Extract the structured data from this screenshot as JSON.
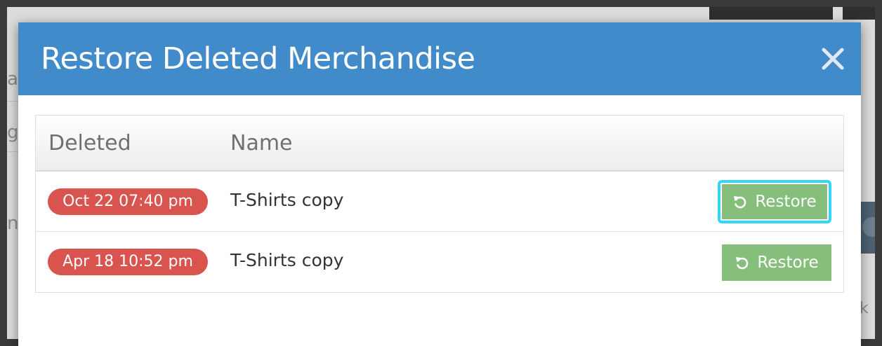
{
  "modal": {
    "title": "Restore Deleted Merchandise",
    "close_icon": "close-icon"
  },
  "table": {
    "columns": [
      "Deleted",
      "Name"
    ],
    "rows": [
      {
        "deleted": "Oct 22 07:40 pm",
        "name": "T-Shirts copy",
        "action": "Restore",
        "focused": true
      },
      {
        "deleted": "Apr 18 10:52 pm",
        "name": "T-Shirts copy",
        "action": "Restore",
        "focused": false
      }
    ],
    "action_icon": "restore-icon"
  },
  "background": {
    "fragment_a": "a",
    "fragment_b": "g",
    "fragment_c": "n",
    "fragment_d": "k"
  },
  "colors": {
    "header": "#428bca",
    "date_badge": "#d9534f",
    "restore_button": "#85bf7b",
    "focus_ring": "#35d4f2"
  }
}
